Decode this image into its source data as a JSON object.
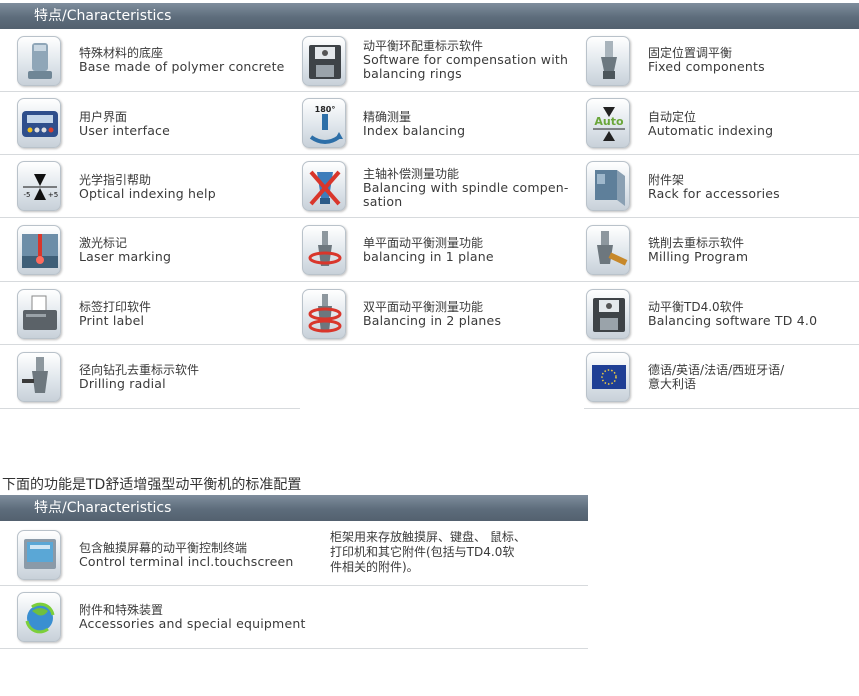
{
  "section1": {
    "header": "特点/Characteristics",
    "items": [
      {
        "cn": "特殊材料的底座",
        "en": "Base made of polymer concrete",
        "icon": "polymer-base-icon"
      },
      {
        "cn": "动平衡环配重标示软件",
        "en": "Software for compensation with",
        "en2": "balancing rings",
        "icon": "floppy-disk-icon"
      },
      {
        "cn": "固定位置调平衡",
        "en": "Fixed components",
        "icon": "spindle-tool-icon"
      },
      {
        "cn": "用户界面",
        "en": "User interface",
        "icon": "control-panel-icon"
      },
      {
        "cn": "精确测量",
        "en": "Index balancing",
        "icon": "rotation-180-icon",
        "badge": "180°"
      },
      {
        "cn": "自动定位",
        "en": "Automatic indexing",
        "icon": "auto-indexing-icon",
        "badge": "Auto"
      },
      {
        "cn": "光学指引帮助",
        "en": "Optical indexing help",
        "icon": "optical-indexing-icon",
        "scale_left": "-5",
        "scale_right": "+5"
      },
      {
        "cn": "主轴补偿测量功能",
        "en": "Balancing with spindle compen-",
        "en2": "sation",
        "icon": "spindle-cross-icon"
      },
      {
        "cn": "附件架",
        "en": "Rack for accessories",
        "icon": "accessory-rack-icon"
      },
      {
        "cn": "激光标记",
        "en": "Laser marking",
        "icon": "laser-marking-icon"
      },
      {
        "cn": "单平面动平衡测量功能",
        "en": "balancing in 1 plane",
        "icon": "single-plane-icon"
      },
      {
        "cn": "铣削去重标示软件",
        "en": "Milling Program",
        "icon": "milling-icon"
      },
      {
        "cn": "标签打印软件",
        "en": "Print label",
        "icon": "label-printer-icon"
      },
      {
        "cn": "双平面动平衡测量功能",
        "en": "Balancing in 2 planes",
        "icon": "two-plane-icon"
      },
      {
        "cn": "动平衡TD4.0软件",
        "en": "Balancing software TD 4.0",
        "icon": "floppy-disk-icon"
      },
      {
        "cn": "径向钻孔去重标示软件",
        "en": "Drilling radial",
        "icon": "drilling-radial-icon"
      },
      {
        "cn": "德语/英语/法语/西班牙语/",
        "en": "意大利语",
        "icon": "eu-flag-icon"
      }
    ]
  },
  "section2_title": "下面的功能是TD舒适增强型动平衡机的标准配置",
  "section2": {
    "header": "特点/Characteristics",
    "items": [
      {
        "cn": "包含触摸屏幕的动平衡控制终端",
        "en": "Control terminal incl.touchscreen",
        "icon": "touchscreen-terminal-icon"
      },
      {
        "cn": "附件和特殊装置",
        "en": "Accessories and special equipment",
        "icon": "accessories-globe-icon"
      }
    ],
    "note": "柜架用来存放触摸屏、键盘、 鼠标、\n打印机和其它附件(包括与TD4.0软\n件相关的附件)。"
  }
}
